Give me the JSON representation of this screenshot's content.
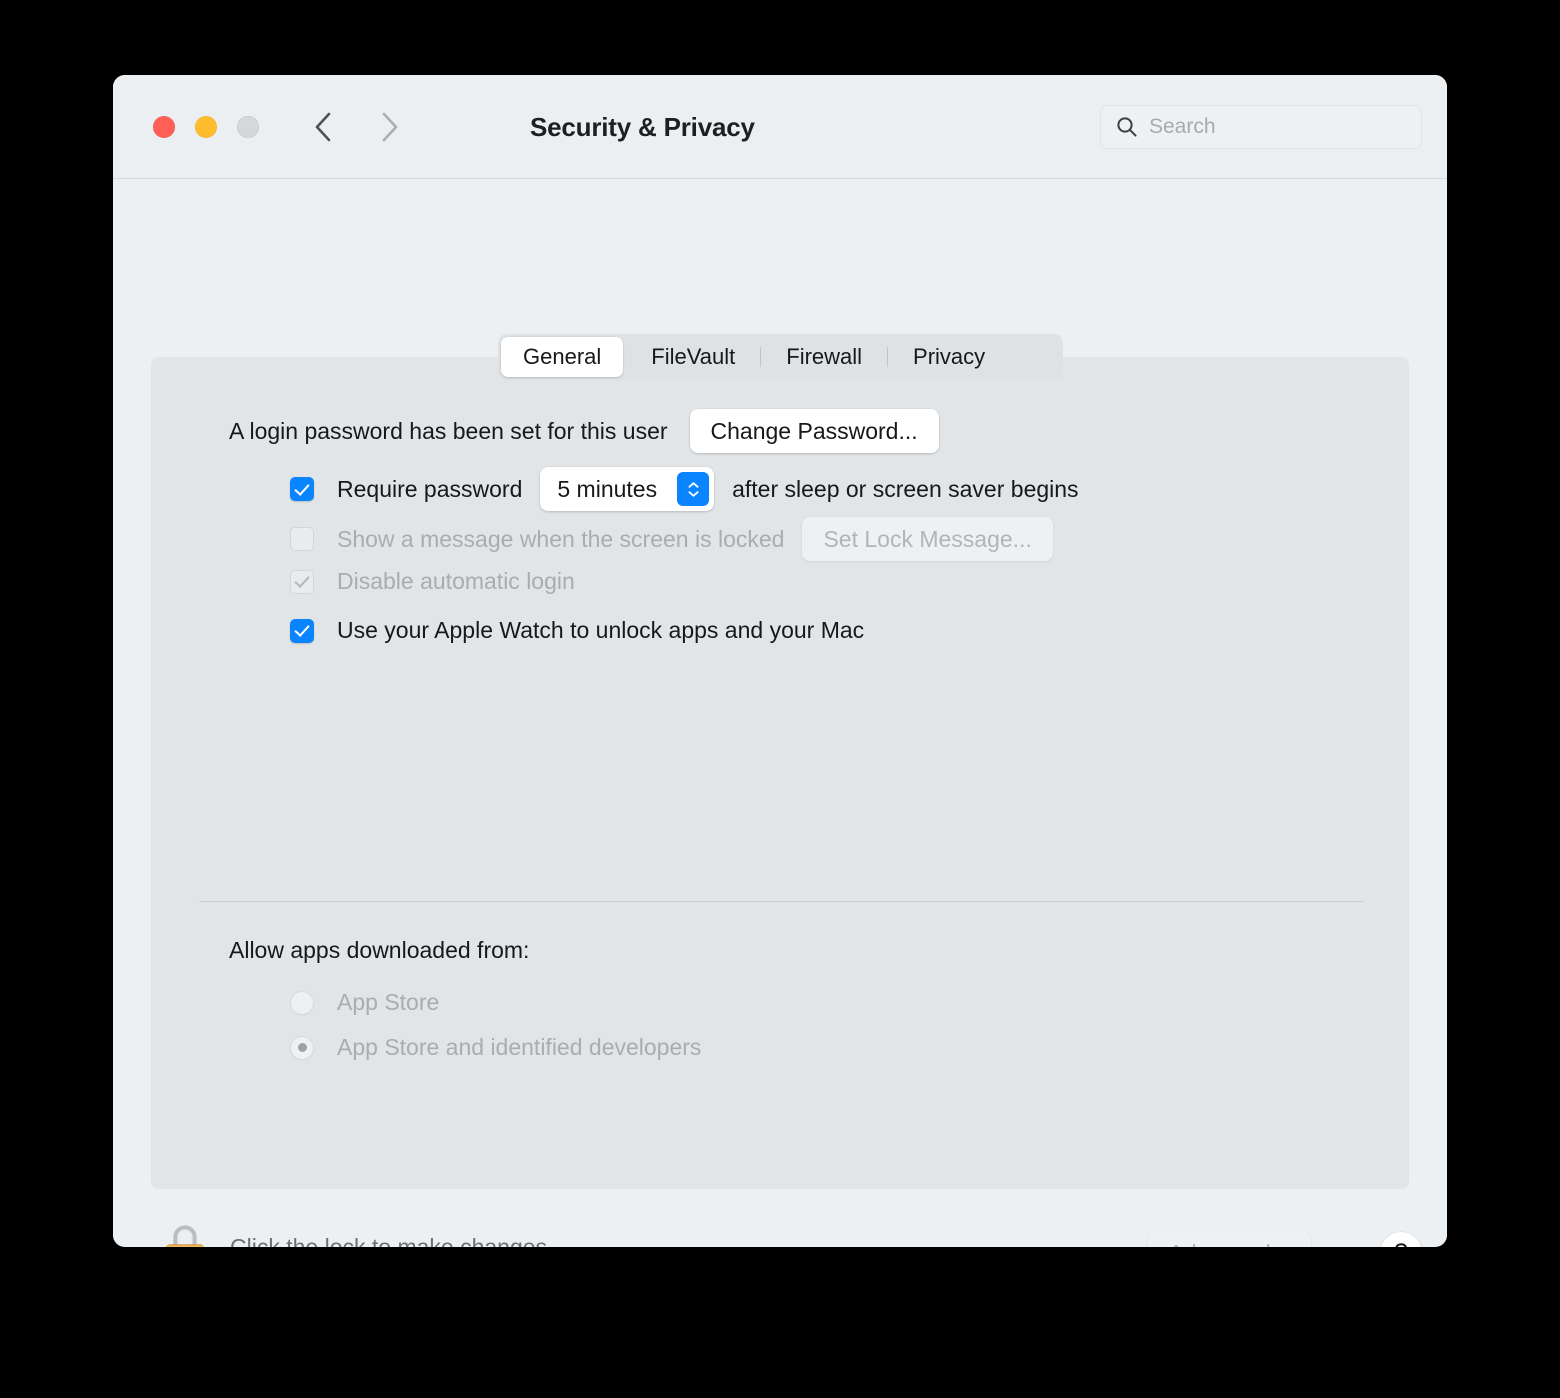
{
  "window": {
    "title": "Security & Privacy",
    "traffic_lights": {
      "close": "close-button",
      "minimize": "minimize-button",
      "zoom": "zoom-button"
    },
    "nav": {
      "back": "back-arrow",
      "forward": "forward-arrow",
      "show_all": "show-all-grid"
    }
  },
  "search": {
    "placeholder": "Search",
    "value": ""
  },
  "tabs": [
    {
      "label": "General",
      "selected": true
    },
    {
      "label": "FileVault",
      "selected": false
    },
    {
      "label": "Firewall",
      "selected": false
    },
    {
      "label": "Privacy",
      "selected": false
    }
  ],
  "general": {
    "password_status": "A login password has been set for this user",
    "change_password_label": "Change Password...",
    "require_password": {
      "label": "Require password",
      "checked": true,
      "interval": "5 minutes",
      "suffix": "after sleep or screen saver begins"
    },
    "show_message": {
      "label": "Show a message when the screen is locked",
      "checked": false,
      "enabled": false,
      "button_label": "Set Lock Message..."
    },
    "disable_auto_login": {
      "label": "Disable automatic login",
      "checked": true,
      "enabled": false
    },
    "apple_watch": {
      "label": "Use your Apple Watch to unlock apps and your Mac",
      "checked": true
    },
    "allow_apps": {
      "heading": "Allow apps downloaded from:",
      "options": [
        {
          "label": "App Store",
          "selected": false
        },
        {
          "label": "App Store and identified developers",
          "selected": true
        }
      ]
    }
  },
  "footer": {
    "lock_text": "Click the lock to make changes.",
    "lock_state": "locked",
    "advanced_label": "Advanced...",
    "help_label": "?"
  },
  "colors": {
    "accent": "#0a84ff",
    "window_bg": "#ecf0f2",
    "panel_bg": "#e2e5e7",
    "close": "#ff5f57",
    "minimize": "#ffbd2e",
    "zoom_disabled": "#d5d8da",
    "lock_body": "#efa93c",
    "text": "#16181a",
    "text_dim": "#a8adb2"
  }
}
